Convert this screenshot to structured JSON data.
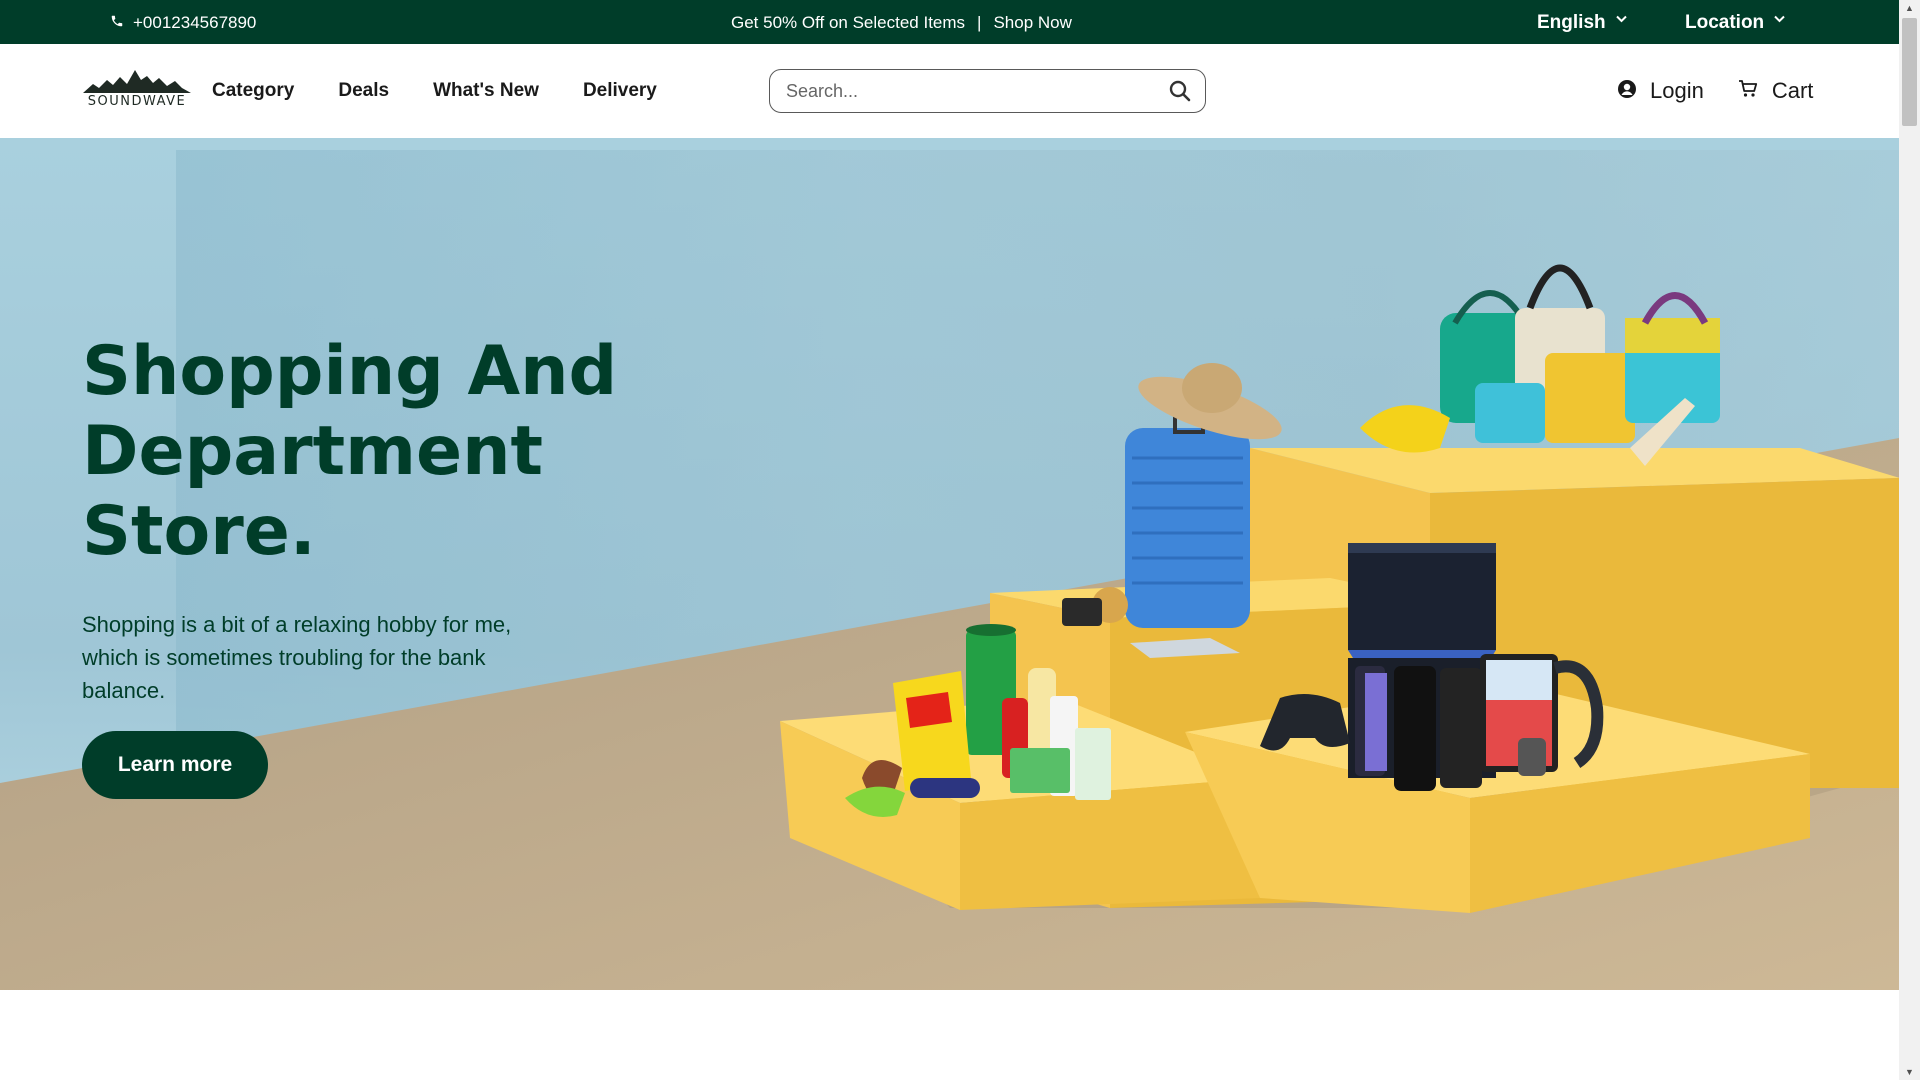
{
  "topbar": {
    "phone_icon": "phone-icon",
    "phone": "+001234567890",
    "promo_text": "Get 50% Off on Selected Items",
    "promo_sep": "|",
    "promo_link": "Shop Now",
    "language": "English",
    "location": "Location"
  },
  "header": {
    "logo_text": "SOUNDWAVE",
    "nav": [
      "Category",
      "Deals",
      "What's New",
      "Delivery"
    ],
    "search_placeholder": "Search...",
    "login": "Login",
    "cart": "Cart"
  },
  "hero": {
    "title": "Shopping And Department Store.",
    "subtitle": "Shopping is a bit of a relaxing hobby for me, which is sometimes troubling for the bank balance.",
    "cta": "Learn more",
    "illustration": "product-display-podiums-illustration"
  },
  "colors": {
    "brand": "#003d29",
    "podium": "#f5c64a",
    "sky": "#a9d0de"
  }
}
